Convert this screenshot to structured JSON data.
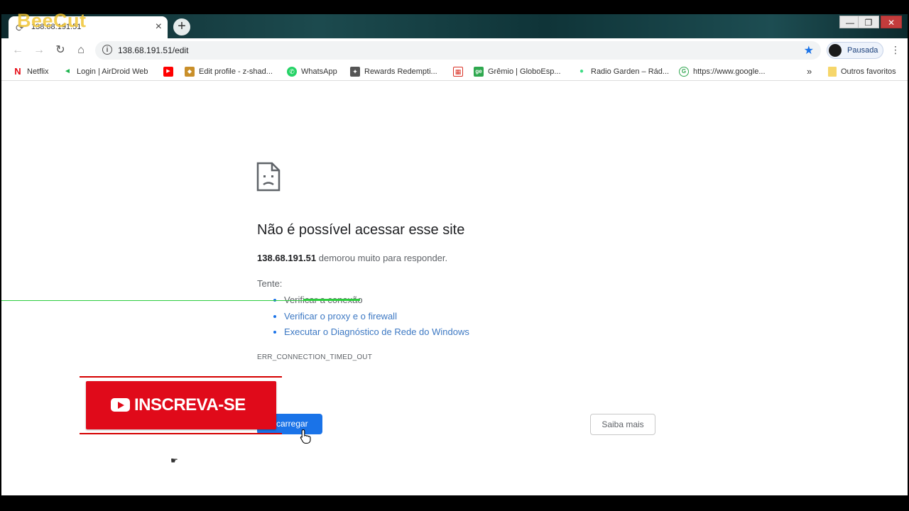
{
  "watermark": {
    "text": "BeeCut"
  },
  "tab": {
    "title": "138.68.191.51"
  },
  "toolbar": {
    "url": "138.68.191.51/edit",
    "profile_label": "Pausada"
  },
  "bookmarks": [
    {
      "label": "Netflix",
      "icon": "netflix-icon",
      "color": "#e50914",
      "glyph": "N"
    },
    {
      "label": "Login | AirDroid Web",
      "icon": "airdroid-icon",
      "color": "#1ab34b",
      "glyph": "◄"
    },
    {
      "label": "",
      "icon": "youtube-icon",
      "color": "#ff0000",
      "glyph": "▶"
    },
    {
      "label": "Edit profile - z-shad...",
      "icon": "profile-icon",
      "color": "#c98f2a",
      "glyph": "◆"
    },
    {
      "label": "WhatsApp",
      "icon": "whatsapp-icon",
      "color": "#25d366",
      "glyph": "✆"
    },
    {
      "label": "Rewards Redempti...",
      "icon": "rewards-icon",
      "color": "#555555",
      "glyph": "✦"
    },
    {
      "label": "",
      "icon": "calendar-icon",
      "color": "#d93025",
      "glyph": "▦"
    },
    {
      "label": "Grêmio | GloboEsp...",
      "icon": "ge-icon",
      "color": "#2fa84f",
      "glyph": "ge"
    },
    {
      "label": "Radio Garden – Rád...",
      "icon": "radio-garden-icon",
      "color": "#3ddc84",
      "glyph": "●"
    },
    {
      "label": "https://www.google...",
      "icon": "google-icon",
      "color": "#34a853",
      "glyph": "G"
    }
  ],
  "bookmarks_more": "»",
  "other_bookmarks": "Outros favoritos",
  "error": {
    "title": "Não é possível acessar esse site",
    "host": "138.68.191.51",
    "desc_rest": " demorou muito para responder.",
    "try_label": "Tente:",
    "suggestions": [
      "Verificar a conexão",
      "Verificar o proxy e o firewall",
      "Executar o Diagnóstico de Rede do Windows"
    ],
    "code": "ERR_CONNECTION_TIMED_OUT",
    "reload_label": "ecarregar",
    "learn_label": "Saiba mais"
  },
  "subscribe": {
    "label": "INSCREVA-SE"
  },
  "colors": {
    "accent": "#1a73e8",
    "subscribe": "#e00a1a",
    "tabstrip": "#1c4a4e"
  }
}
